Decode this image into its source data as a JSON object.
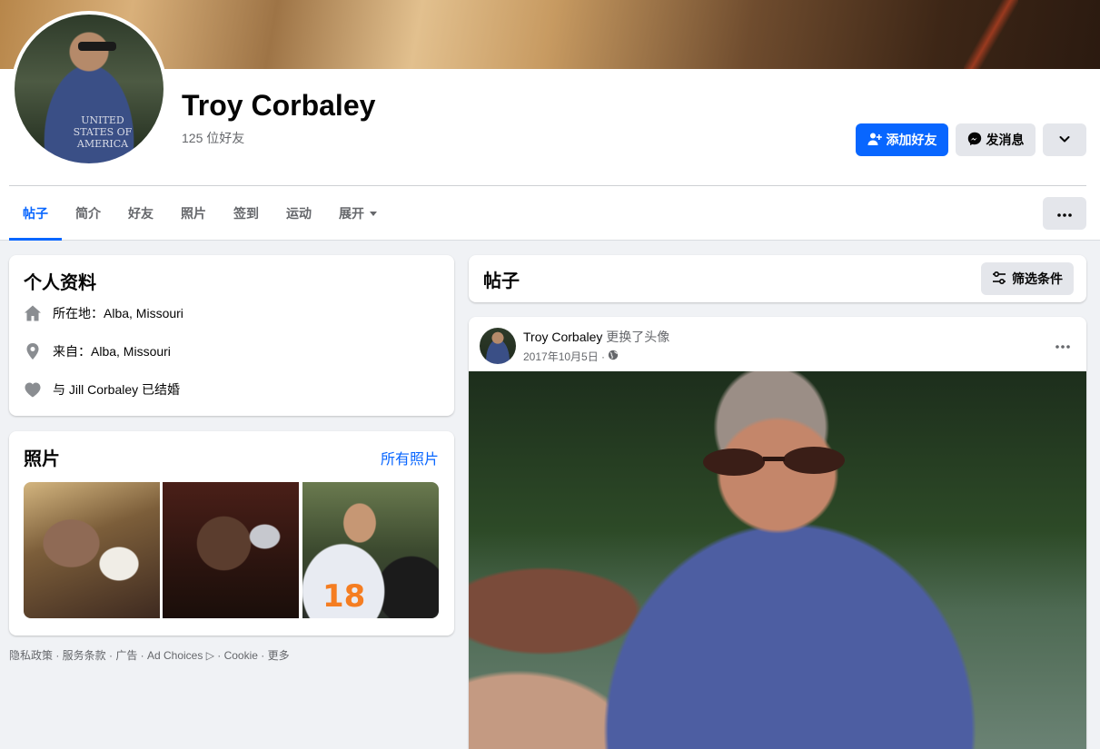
{
  "profile": {
    "name": "Troy Corbaley",
    "friends_count": "125 位好友",
    "avatar_shirt_text": "UNITED STATES OF AMERICA"
  },
  "actions": {
    "add_friend": "添加好友",
    "message": "发消息"
  },
  "tabs": [
    {
      "label": "帖子",
      "active": true
    },
    {
      "label": "简介"
    },
    {
      "label": "好友"
    },
    {
      "label": "照片"
    },
    {
      "label": "签到"
    },
    {
      "label": "运动"
    },
    {
      "label": "展开"
    }
  ],
  "intro": {
    "title": "个人资料",
    "items": [
      {
        "icon": "home-icon",
        "text": "所在地：Alba, Missouri"
      },
      {
        "icon": "location-pin-icon",
        "text": "来自：Alba, Missouri"
      },
      {
        "icon": "heart-icon",
        "text": "与 Jill Corbaley 已结婚"
      }
    ]
  },
  "photos": {
    "title": "照片",
    "all_link": "所有照片",
    "jersey_number": "18"
  },
  "footer": {
    "text": "隐私政策 · 服务条款 · 广告 · Ad Choices ▷ · Cookie · 更多"
  },
  "posts": {
    "title": "帖子",
    "filter": "筛选条件",
    "items": [
      {
        "author": "Troy Corbaley",
        "action": "更换了头像",
        "date": "2017年10月5日 ·"
      }
    ]
  },
  "colors": {
    "brand": "#0866ff",
    "background": "#f0f2f5",
    "secondary_button": "#e4e6eb"
  }
}
